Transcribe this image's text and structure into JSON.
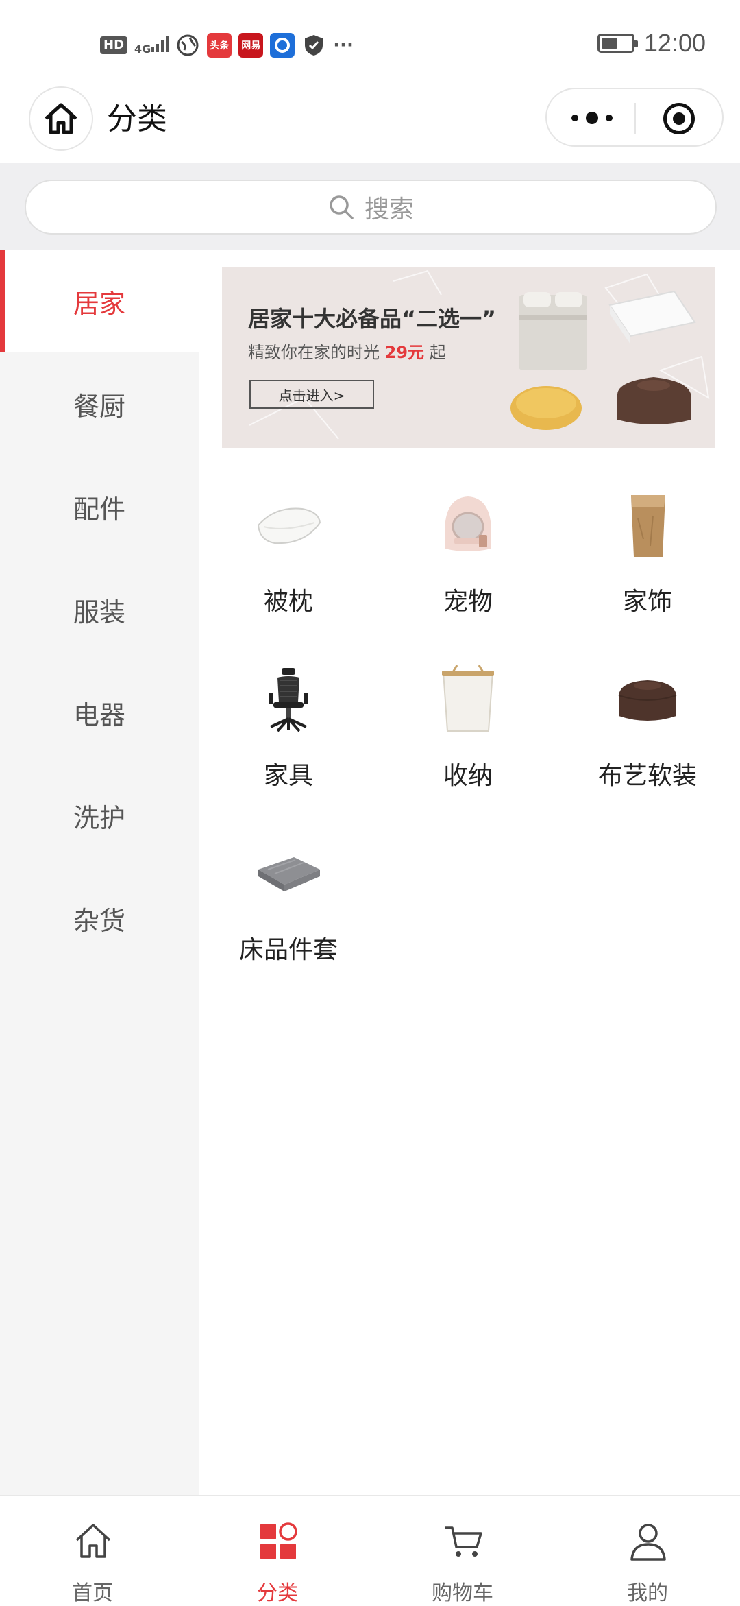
{
  "status_bar": {
    "network_chip": "HD",
    "signal": "4G",
    "apps": [
      {
        "name": "globe-icon",
        "text": "",
        "color": "#444444"
      },
      {
        "name": "toutiao-app-icon",
        "text": "头条",
        "color": "#e4393c"
      },
      {
        "name": "netease-app-icon",
        "text": "网易",
        "color": "#c8161d"
      },
      {
        "name": "qq-browser-app-icon",
        "text": "",
        "color": "#1e6fd9"
      },
      {
        "name": "shield-app-icon",
        "text": "",
        "color": "#444444"
      }
    ],
    "overflow": "···",
    "battery_level": 0.55,
    "time": "12:00"
  },
  "nav": {
    "title": "分类",
    "home_icon": "home-icon",
    "more_icon": "more-icon",
    "target_icon": "target-icon"
  },
  "search": {
    "placeholder": "搜索",
    "icon": "search-icon"
  },
  "sidebar": {
    "active_index": 0,
    "items": [
      {
        "label": "居家"
      },
      {
        "label": "餐厨"
      },
      {
        "label": "配件"
      },
      {
        "label": "服装"
      },
      {
        "label": "电器"
      },
      {
        "label": "洗护"
      },
      {
        "label": "杂货"
      }
    ]
  },
  "banner": {
    "title": "居家十大必备品“二选一”",
    "subtitle_prefix": "精致你在家的时光",
    "price": "29元",
    "subtitle_suffix": "起",
    "button": "点击进入>"
  },
  "categories": [
    {
      "label": "被枕",
      "icon": "pillow-icon"
    },
    {
      "label": "宠物",
      "icon": "pet-litter-box-icon"
    },
    {
      "label": "家饰",
      "icon": "paper-bag-icon"
    },
    {
      "label": "家具",
      "icon": "office-chair-icon"
    },
    {
      "label": "收纳",
      "icon": "storage-basket-icon"
    },
    {
      "label": "布艺软装",
      "icon": "bean-bag-icon"
    },
    {
      "label": "床品件套",
      "icon": "folded-blanket-icon"
    }
  ],
  "tabbar": {
    "active_index": 1,
    "items": [
      {
        "label": "首页",
        "icon": "home-icon"
      },
      {
        "label": "分类",
        "icon": "category-icon"
      },
      {
        "label": "购物车",
        "icon": "cart-icon"
      },
      {
        "label": "我的",
        "icon": "user-icon"
      }
    ]
  },
  "colors": {
    "accent": "#e4393c",
    "sidebar_bg": "#f5f5f5",
    "search_bg": "#efeff1"
  }
}
